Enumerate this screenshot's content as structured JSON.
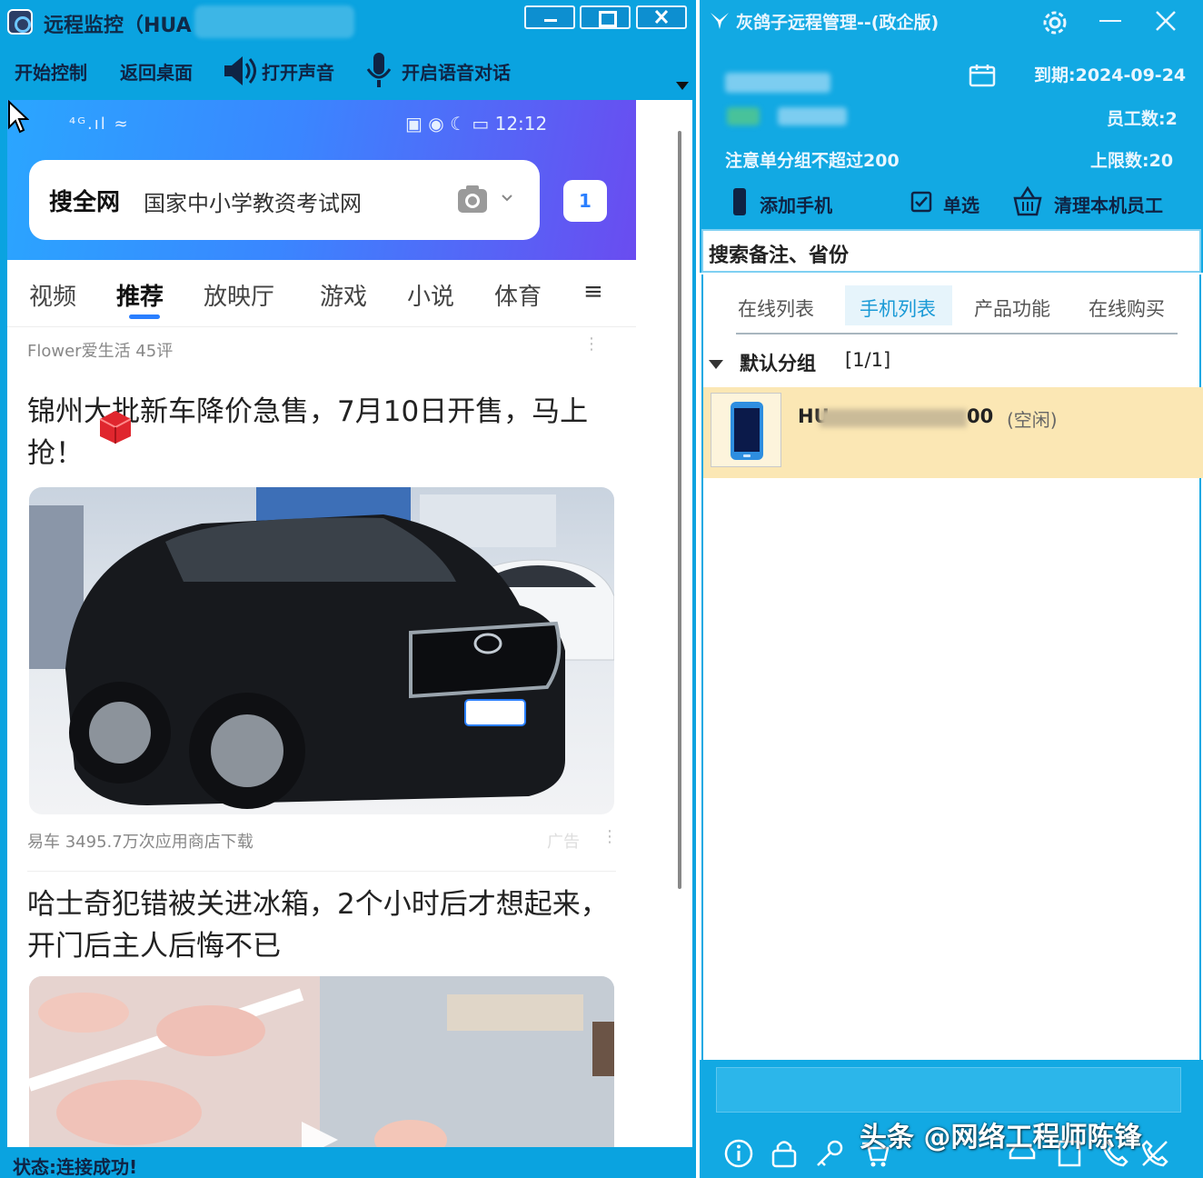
{
  "left_window": {
    "title": "远程监控（HUA",
    "toolbar": {
      "start_control": "开始控制",
      "back_desktop": "返回桌面",
      "open_sound": "打开声音",
      "voice_chat": "开启语音对话"
    },
    "status": "状态:连接成功!"
  },
  "phone": {
    "status_left": "⁴ᴳ.ıl ≈",
    "time": "12:12",
    "search": {
      "prefix": "搜全网",
      "query": "国家中小学教资考试网"
    },
    "tab_count": "1",
    "channels": [
      "视频",
      "推荐",
      "放映厅",
      "游戏",
      "小说",
      "体育"
    ],
    "active_channel": "推荐",
    "menu_glyph": "≡",
    "feed": [
      {
        "source": "Flower爱生活 45评",
        "headline": "锦州大批新车降价急售，7月10日开售，马上抢！"
      },
      {
        "source": "易车 3495.7万次应用商店下载",
        "ad_label": "广告",
        "headline": "哈士奇犯错被关进冰箱，2个小时后才想起来，开门后主人后悔不已"
      }
    ]
  },
  "right_window": {
    "title": "灰鸽子远程管理--(政企版)",
    "expire": "到期:2024-09-24",
    "staff_count": "员工数:2",
    "note": "注意单分组不超过200",
    "limit": "上限数:20",
    "actions": {
      "add_phone": "添加手机",
      "single_select": "单选",
      "clear_staff": "清理本机员工"
    },
    "search_placeholder": "搜索备注、省份",
    "tabs": [
      "在线列表",
      "手机列表",
      "产品功能",
      "在线购买"
    ],
    "active_tab": "手机列表",
    "group": {
      "name": "默认分组",
      "count": "[1/1]"
    },
    "device": {
      "name_prefix": "HU",
      "name_suffix": "00",
      "state": "(空闲)"
    },
    "bottom_icons": [
      "info-icon",
      "lock-icon",
      "key-icon",
      "cart-icon",
      "car-icon",
      "document-icon",
      "phone-icon",
      "phone-off-icon"
    ]
  },
  "watermark": "头条 @网络工程师陈锋",
  "colors": {
    "window_blue": "#0aa3e0",
    "panel_blue": "#12a9e3",
    "accent": "#2a7fff",
    "selected_row": "#fbe7b4"
  }
}
